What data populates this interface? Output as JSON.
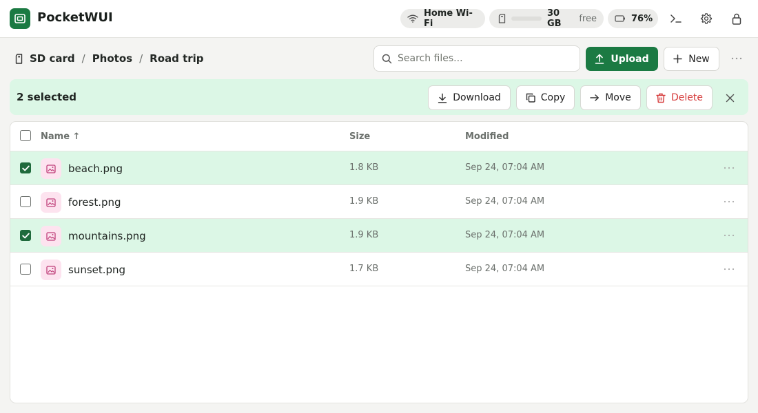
{
  "app": {
    "title": "PocketWUI"
  },
  "status": {
    "wifi": "Home Wi-Fi",
    "storage_amount": "30 GB",
    "storage_suffix": "free",
    "storage_used_fraction": 0.0,
    "battery": "76%"
  },
  "breadcrumb": [
    "SD card",
    "Photos",
    "Road trip"
  ],
  "search": {
    "placeholder": "Search files..."
  },
  "toolbar": {
    "upload_label": "Upload",
    "new_label": "New"
  },
  "selection": {
    "count_label": "2 selected",
    "download_label": "Download",
    "copy_label": "Copy",
    "move_label": "Move",
    "delete_label": "Delete"
  },
  "table": {
    "columns": {
      "name": "Name ↑",
      "size": "Size",
      "modified": "Modified"
    },
    "rows": [
      {
        "name": "beach.png",
        "size": "1.8 KB",
        "modified": "Sep 24, 07:04 AM",
        "selected": true
      },
      {
        "name": "forest.png",
        "size": "1.9 KB",
        "modified": "Sep 24, 07:04 AM",
        "selected": false
      },
      {
        "name": "mountains.png",
        "size": "1.9 KB",
        "modified": "Sep 24, 07:04 AM",
        "selected": true
      },
      {
        "name": "sunset.png",
        "size": "1.7 KB",
        "modified": "Sep 24, 07:04 AM",
        "selected": false
      }
    ]
  },
  "colors": {
    "brand": "#1b7a43",
    "selection_bg": "#dcf7e6",
    "danger": "#d53838",
    "file_icon_bg": "#fde3ef",
    "file_icon_fg": "#c0407a"
  },
  "icons": {
    "logo": "app-logo-icon",
    "wifi": "wifi-icon",
    "storage": "sd-card-icon",
    "battery": "battery-icon",
    "terminal": "terminal-icon",
    "settings": "gear-icon",
    "lock": "lock-icon",
    "file": "image-file-icon"
  }
}
